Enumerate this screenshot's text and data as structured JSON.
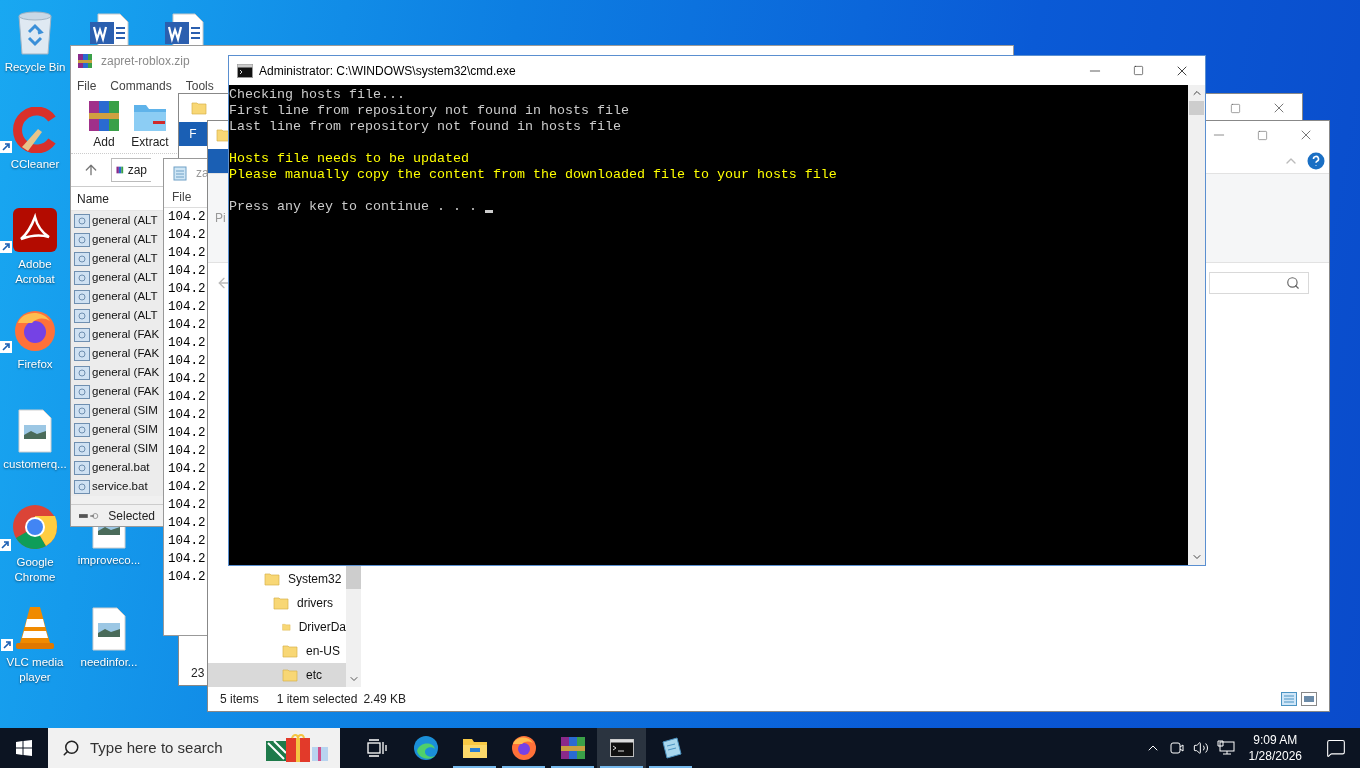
{
  "desktop_icons": [
    {
      "kind": "recycle",
      "label": "Recycle Bin"
    },
    {
      "kind": "word"
    },
    {
      "kind": "word"
    },
    {
      "kind": "ccleaner",
      "label": "CCleaner",
      "shortcut": true
    },
    {
      "kind": "acrobat",
      "label": "Adobe Acrobat",
      "shortcut": true
    },
    {
      "kind": "firefox",
      "label": "Firefox",
      "shortcut": true
    },
    {
      "kind": "image",
      "label": "customerq..."
    },
    {
      "kind": "chrome",
      "label": "Google Chrome",
      "shortcut": true
    },
    {
      "kind": "image",
      "label": "improveco..."
    },
    {
      "kind": "vlc",
      "label": "VLC media player",
      "shortcut": true
    },
    {
      "kind": "image",
      "label": "needinfor..."
    }
  ],
  "winrar": {
    "title": "zapret-roblox.zip",
    "menu": [
      "File",
      "Commands",
      "Tools"
    ],
    "toolbar": [
      {
        "kind": "add",
        "label": "Add"
      },
      {
        "kind": "extract",
        "label": "Extract"
      }
    ],
    "path": "zap",
    "column": "Name",
    "files": [
      "general (ALT",
      "general (ALT",
      "general (ALT",
      "general (ALT",
      "general (ALT",
      "general (ALT",
      "general (FAK",
      "general (FAK",
      "general (FAK",
      "general (FAK",
      "general (SIM",
      "general (SIM",
      "general (SIM",
      "general.bat",
      "service.bat"
    ],
    "status": "Selected"
  },
  "explorer_back": {
    "ribbon_tab": "F",
    "status": "23"
  },
  "notepad": {
    "title": "za",
    "menu": [
      "File"
    ],
    "lines": [
      "104.2",
      "104.2",
      "104.2",
      "104.2",
      "104.2",
      "104.2",
      "104.2",
      "104.2",
      "104.2",
      "104.2",
      "104.2",
      "104.2",
      "104.2",
      "104.2",
      "104.2",
      "104.2",
      "104.2",
      "104.2",
      "104.2",
      "104.2",
      "104.2"
    ]
  },
  "explorer": {
    "ribbon_text": "Pi",
    "tree": [
      {
        "label": "System32",
        "selected": false,
        "children": [
          {
            "label": "drivers",
            "selected": false,
            "children": [
              {
                "label": "DriverDa",
                "selected": false
              },
              {
                "label": "en-US",
                "selected": false
              },
              {
                "label": "etc",
                "selected": true
              }
            ]
          }
        ]
      }
    ],
    "status": {
      "items": "5 items",
      "selection": "1 item selected",
      "size": "2.49 KB"
    }
  },
  "cmd": {
    "title": "Administrator: C:\\WINDOWS\\system32\\cmd.exe",
    "blocks": [
      {
        "color": "#cccccc",
        "lines": [
          "Checking hosts file...",
          "First line from repository not found in hosts file",
          "Last line from repository not found in hosts file"
        ],
        "cursor": false
      },
      {
        "color": "#ffff00",
        "lines": [
          "Hosts file needs to be updated",
          "Please manually copy the content from the downloaded file to your hosts file"
        ],
        "cursor": false
      },
      {
        "color": "#cccccc",
        "lines": [
          "Press any key to continue . . . "
        ],
        "cursor": true
      }
    ]
  },
  "taskbar": {
    "search_placeholder": "Type here to search",
    "apps": [
      {
        "kind": "taskview",
        "running": false,
        "selected": false
      },
      {
        "kind": "edge",
        "running": false,
        "selected": false
      },
      {
        "kind": "explorer",
        "running": true,
        "selected": false
      },
      {
        "kind": "firefox",
        "running": true,
        "selected": false
      },
      {
        "kind": "winrar",
        "running": true,
        "selected": false
      },
      {
        "kind": "cmd",
        "running": true,
        "selected": true
      },
      {
        "kind": "notepad",
        "running": true,
        "selected": false
      }
    ],
    "time": "9:09 AM",
    "date": "1/28/2026"
  }
}
